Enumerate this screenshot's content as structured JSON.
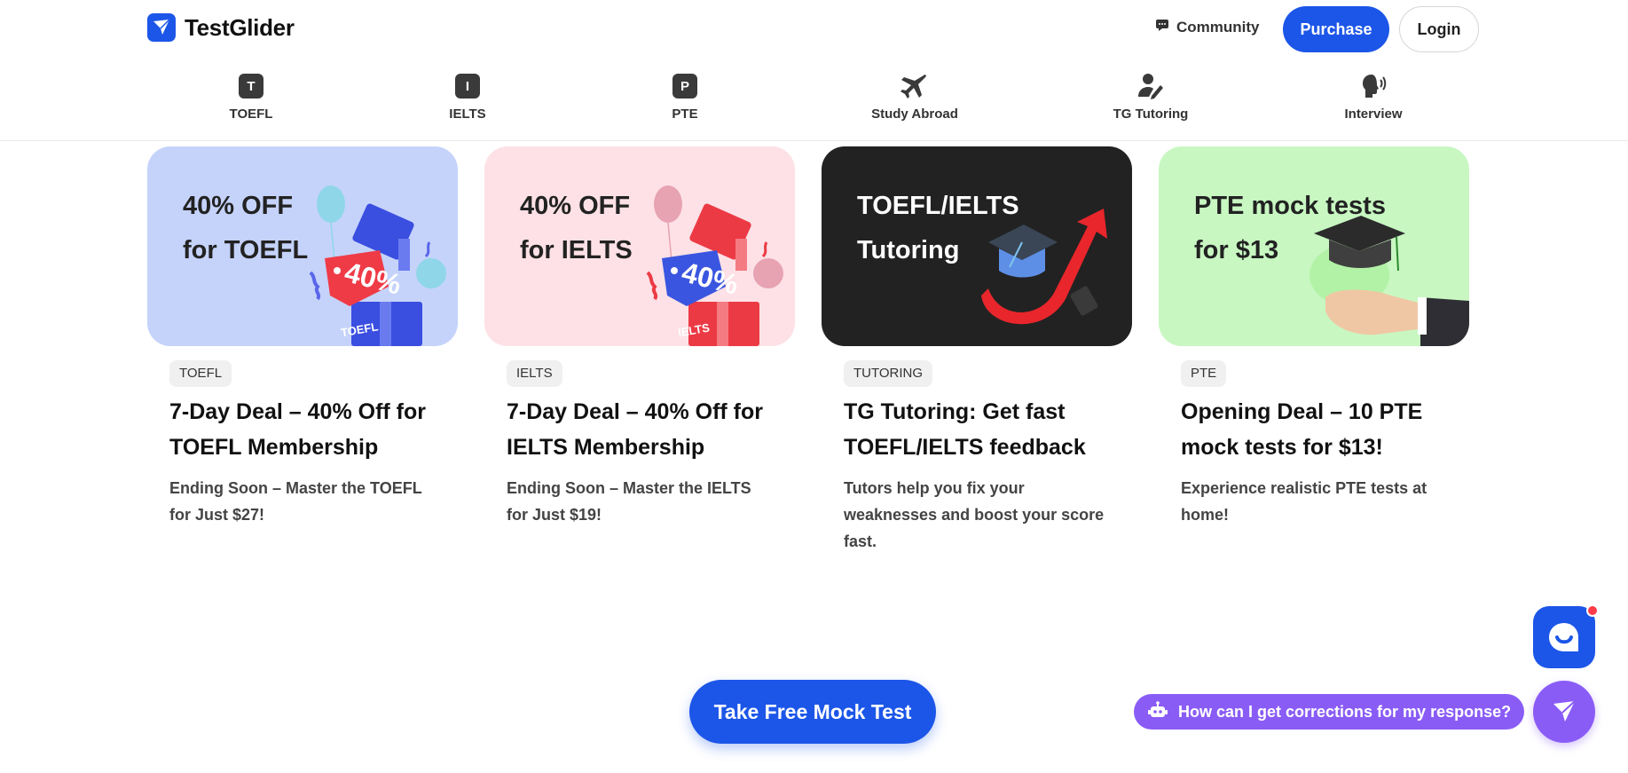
{
  "header": {
    "logo_text": "TestGlider",
    "community_label": "Community",
    "purchase_label": "Purchase",
    "login_label": "Login"
  },
  "nav": {
    "items": [
      {
        "label": "TOEFL",
        "icon": "letter-t-icon",
        "glyph": "T"
      },
      {
        "label": "IELTS",
        "icon": "letter-i-icon",
        "glyph": "I"
      },
      {
        "label": "PTE",
        "icon": "letter-p-icon",
        "glyph": "P"
      },
      {
        "label": "Study Abroad",
        "icon": "airplane-icon"
      },
      {
        "label": "TG Tutoring",
        "icon": "tutor-icon"
      },
      {
        "label": "Interview",
        "icon": "speaking-head-icon"
      }
    ]
  },
  "cards": [
    {
      "banner_text": "40% OFF\nfor TOEFL",
      "banner_color": "#c5d3fb",
      "badge_text": "40%",
      "box_label": "TOEFL",
      "tag": "TOEFL",
      "title": "7-Day Deal – 40% Off for TOEFL Membership",
      "description": "Ending Soon – Master the TOEFL for Just $27!"
    },
    {
      "banner_text": "40% OFF\nfor IELTS",
      "banner_color": "#fde1e6",
      "badge_text": "40%",
      "box_label": "IELTS",
      "tag": "IELTS",
      "title": "7-Day Deal – 40% Off for IELTS Membership",
      "description": "Ending Soon – Master the IELTS for Just $19!"
    },
    {
      "banner_text": "TOEFL/IELTS\nTutoring",
      "banner_color": "#222222",
      "tag": "TUTORING",
      "title": "TG Tutoring: Get fast TOEFL/IELTS feedback",
      "description": "Tutors help you fix your weaknesses and boost your score fast."
    },
    {
      "banner_text": "PTE mock tests\nfor $13",
      "banner_color": "#c8f7c2",
      "tag": "PTE",
      "title": "Opening Deal – 10 PTE mock tests for $13!",
      "description": "Experience realistic PTE tests at home!"
    }
  ],
  "cta": {
    "mock_test_label": "Take Free Mock Test"
  },
  "assistant": {
    "prompt": "How can I get corrections for my response?"
  },
  "colors": {
    "brand_blue": "#1c56e8",
    "assistant_purple": "#8a5cf6",
    "notification_red": "#ff3b4a"
  }
}
